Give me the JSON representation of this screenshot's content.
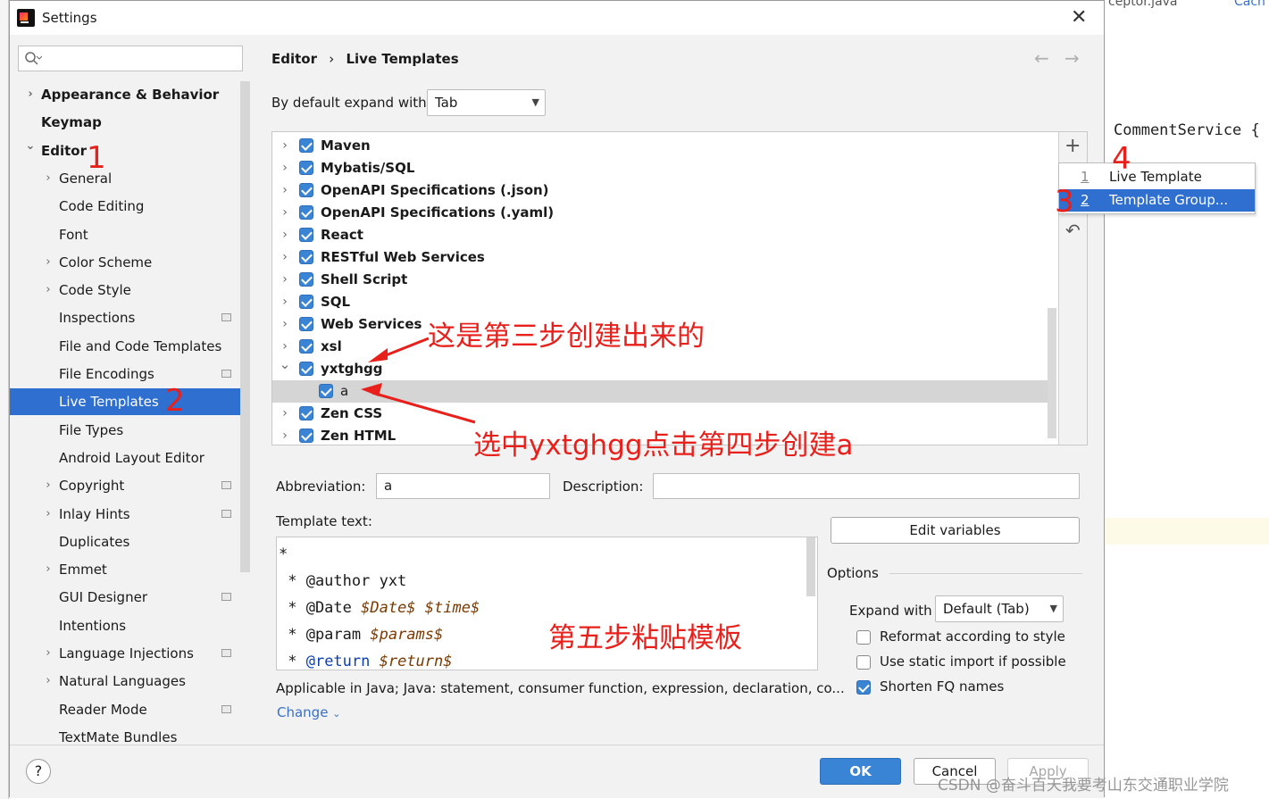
{
  "window": {
    "title": "Settings"
  },
  "search": {
    "placeholder": ""
  },
  "background_ide": {
    "file_tab": "ceptor.java",
    "file_tab2": "Cach",
    "code_line": "CommentService {"
  },
  "sidebar": {
    "items": [
      {
        "label": "Appearance & Behavior",
        "bold": true,
        "expand": "collapsed"
      },
      {
        "label": "Keymap",
        "bold": true
      },
      {
        "label": "Editor",
        "bold": true,
        "expand": "expanded"
      },
      {
        "label": "General",
        "expand": "collapsed"
      },
      {
        "label": "Code Editing"
      },
      {
        "label": "Font"
      },
      {
        "label": "Color Scheme",
        "expand": "collapsed"
      },
      {
        "label": "Code Style",
        "expand": "collapsed"
      },
      {
        "label": "Inspections",
        "badge": true
      },
      {
        "label": "File and Code Templates"
      },
      {
        "label": "File Encodings",
        "badge": true
      },
      {
        "label": "Live Templates",
        "selected": true
      },
      {
        "label": "File Types"
      },
      {
        "label": "Android Layout Editor"
      },
      {
        "label": "Copyright",
        "expand": "collapsed",
        "badge": true
      },
      {
        "label": "Inlay Hints",
        "expand": "collapsed",
        "badge": true
      },
      {
        "label": "Duplicates"
      },
      {
        "label": "Emmet",
        "expand": "collapsed"
      },
      {
        "label": "GUI Designer",
        "badge": true
      },
      {
        "label": "Intentions"
      },
      {
        "label": "Language Injections",
        "expand": "collapsed",
        "badge": true
      },
      {
        "label": "Natural Languages",
        "expand": "collapsed"
      },
      {
        "label": "Reader Mode",
        "badge": true
      },
      {
        "label": "TextMate Bundles"
      }
    ]
  },
  "breadcrumb": {
    "parent": "Editor",
    "separator": "›",
    "current": "Live Templates"
  },
  "expand_with": {
    "label": "By default expand with",
    "value": "Tab"
  },
  "template_groups": [
    {
      "label": "Maven",
      "checked": true
    },
    {
      "label": "Mybatis/SQL",
      "checked": true
    },
    {
      "label": "OpenAPI Specifications (.json)",
      "checked": true
    },
    {
      "label": "OpenAPI Specifications (.yaml)",
      "checked": true
    },
    {
      "label": "React",
      "checked": true
    },
    {
      "label": "RESTful Web Services",
      "checked": true
    },
    {
      "label": "Shell Script",
      "checked": true
    },
    {
      "label": "SQL",
      "checked": true
    },
    {
      "label": "Web Services",
      "checked": true
    },
    {
      "label": "xsl",
      "checked": true
    },
    {
      "label": "yxtghgg",
      "checked": true,
      "expanded": true
    },
    {
      "label": "a",
      "checked": true,
      "child": true,
      "selected": true
    },
    {
      "label": "Zen CSS",
      "checked": true
    },
    {
      "label": "Zen HTML",
      "checked": true
    }
  ],
  "add_menu": {
    "items": [
      {
        "mnemonic": "1",
        "label": "Live Template"
      },
      {
        "mnemonic": "2",
        "label": "Template Group...",
        "highlighted": true
      }
    ]
  },
  "abbreviation": {
    "label": "Abbreviation:",
    "value": "a"
  },
  "description": {
    "label": "Description:",
    "value": ""
  },
  "template_text": {
    "label": "Template text:",
    "lines": [
      [
        {
          "t": "*",
          "c": "plain"
        }
      ],
      [
        {
          "t": " * @author yxt",
          "c": "plain"
        }
      ],
      [
        {
          "t": " * @Date ",
          "c": "plain"
        },
        {
          "t": "$Date$ $time$",
          "c": "var"
        }
      ],
      [
        {
          "t": " * @param ",
          "c": "plain"
        },
        {
          "t": "$params$",
          "c": "var"
        }
      ],
      [
        {
          "t": " * ",
          "c": "plain"
        },
        {
          "t": "@return",
          "c": "kw"
        },
        {
          "t": " $return$",
          "c": "var"
        }
      ]
    ]
  },
  "edit_variables": {
    "label": "Edit variables"
  },
  "options": {
    "title": "Options",
    "expand_label": "Expand with",
    "expand_value": "Default (Tab)",
    "checkboxes": [
      {
        "label": "Reformat according to style",
        "checked": false
      },
      {
        "label": "Use static import if possible",
        "checked": false
      },
      {
        "label": "Shorten FQ names",
        "checked": true
      }
    ]
  },
  "applicable": {
    "text": "Applicable in Java; Java: statement, consumer function, expression, declaration, co...",
    "change_label": "Change"
  },
  "footer": {
    "help": "?",
    "ok": "OK",
    "cancel": "Cancel",
    "apply": "Apply"
  },
  "annotations": {
    "step1": "1",
    "step2": "2",
    "step3": "3",
    "step4": "4",
    "note_group": "这是第三步创建出来的",
    "note_select": "选中yxtghgg点击第四步创建a",
    "note_paste": "第五步粘贴模板"
  },
  "watermark": "CSDN @奋斗百天我要考山东交通职业学院",
  "colors": {
    "accent": "#3a84d6",
    "selection": "#2f6fcf",
    "annotation": "#e8201c"
  }
}
